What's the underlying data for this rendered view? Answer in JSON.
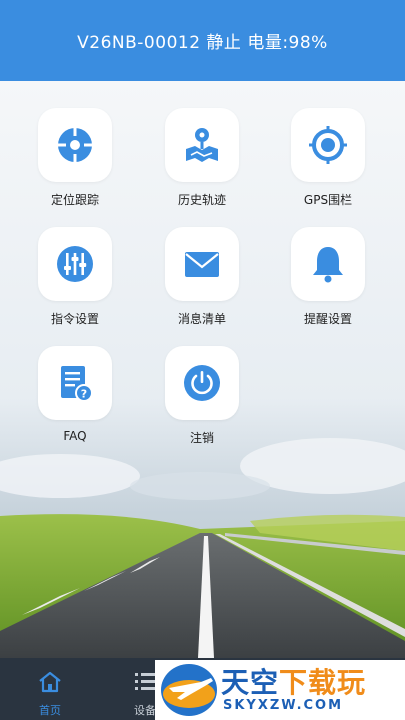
{
  "header": {
    "title": "V26NB-00012 静止 电量:98%"
  },
  "colors": {
    "accent": "#3a8de0",
    "tabbar": "#2a3440",
    "tab_active": "#3a8de0",
    "tab_inactive": "#c7ced6"
  },
  "menu": [
    {
      "label": "定位跟踪",
      "icon": "location-target-icon"
    },
    {
      "label": "历史轨迹",
      "icon": "map-route-icon"
    },
    {
      "label": "GPS围栏",
      "icon": "geofence-target-icon"
    },
    {
      "label": "指令设置",
      "icon": "sliders-icon"
    },
    {
      "label": "消息清单",
      "icon": "envelope-icon"
    },
    {
      "label": "提醒设置",
      "icon": "bell-icon"
    },
    {
      "label": "FAQ",
      "icon": "faq-document-icon"
    },
    {
      "label": "注销",
      "icon": "power-icon"
    }
  ],
  "tabbar": {
    "tabs": [
      {
        "label": "首页",
        "icon": "home-icon",
        "active": true
      },
      {
        "label": "设备",
        "icon": "list-icon",
        "active": false
      }
    ]
  },
  "watermark": {
    "title_part1": "天空",
    "title_part2": "下载玩",
    "url": "SKYXZW.COM"
  }
}
